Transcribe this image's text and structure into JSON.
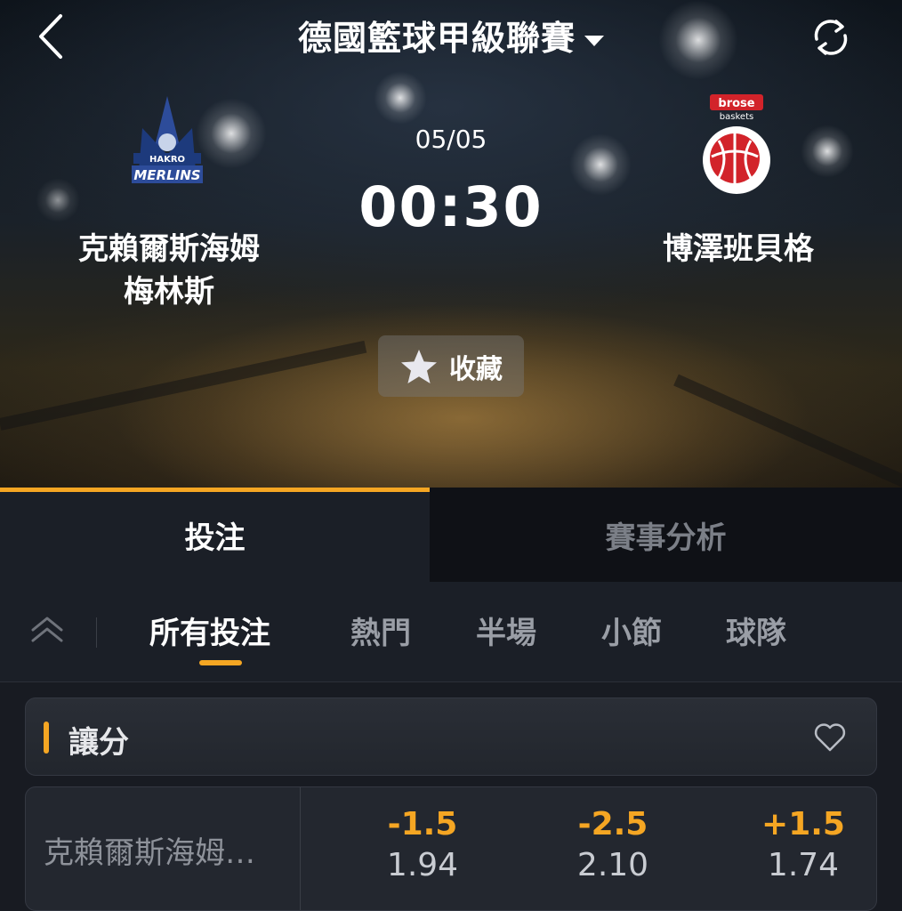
{
  "header": {
    "league_title": "德國籃球甲級聯賽",
    "back_icon": "chevron-left-icon",
    "refresh_icon": "refresh-icon"
  },
  "match": {
    "date": "05/05",
    "time": "00:30",
    "home_team": {
      "name_line1": "克賴爾斯海姆",
      "name_line2": "梅林斯",
      "logo_text_top": "HAKRO",
      "logo_text_bottom": "MERLINS"
    },
    "away_team": {
      "name": "博澤班貝格",
      "logo_text_top": "brose",
      "logo_text_bottom": "baskets"
    },
    "favorite_label": "收藏"
  },
  "tabs": [
    {
      "label": "投注",
      "active": true
    },
    {
      "label": "賽事分析",
      "active": false
    }
  ],
  "subtabs": [
    {
      "label": "所有投注",
      "active": true
    },
    {
      "label": "熱門",
      "active": false
    },
    {
      "label": "半場",
      "active": false
    },
    {
      "label": "小節",
      "active": false
    },
    {
      "label": "球隊",
      "active": false
    }
  ],
  "market": {
    "title": "讓分",
    "row": {
      "team": "克賴爾斯海姆…",
      "odds": [
        {
          "line": "-1.5",
          "price": "1.94"
        },
        {
          "line": "-2.5",
          "price": "2.10"
        },
        {
          "line": "+1.5",
          "price": "1.74"
        }
      ]
    }
  },
  "colors": {
    "accent": "#f5a623",
    "background": "#181b22",
    "away_logo_red": "#d2232a"
  }
}
